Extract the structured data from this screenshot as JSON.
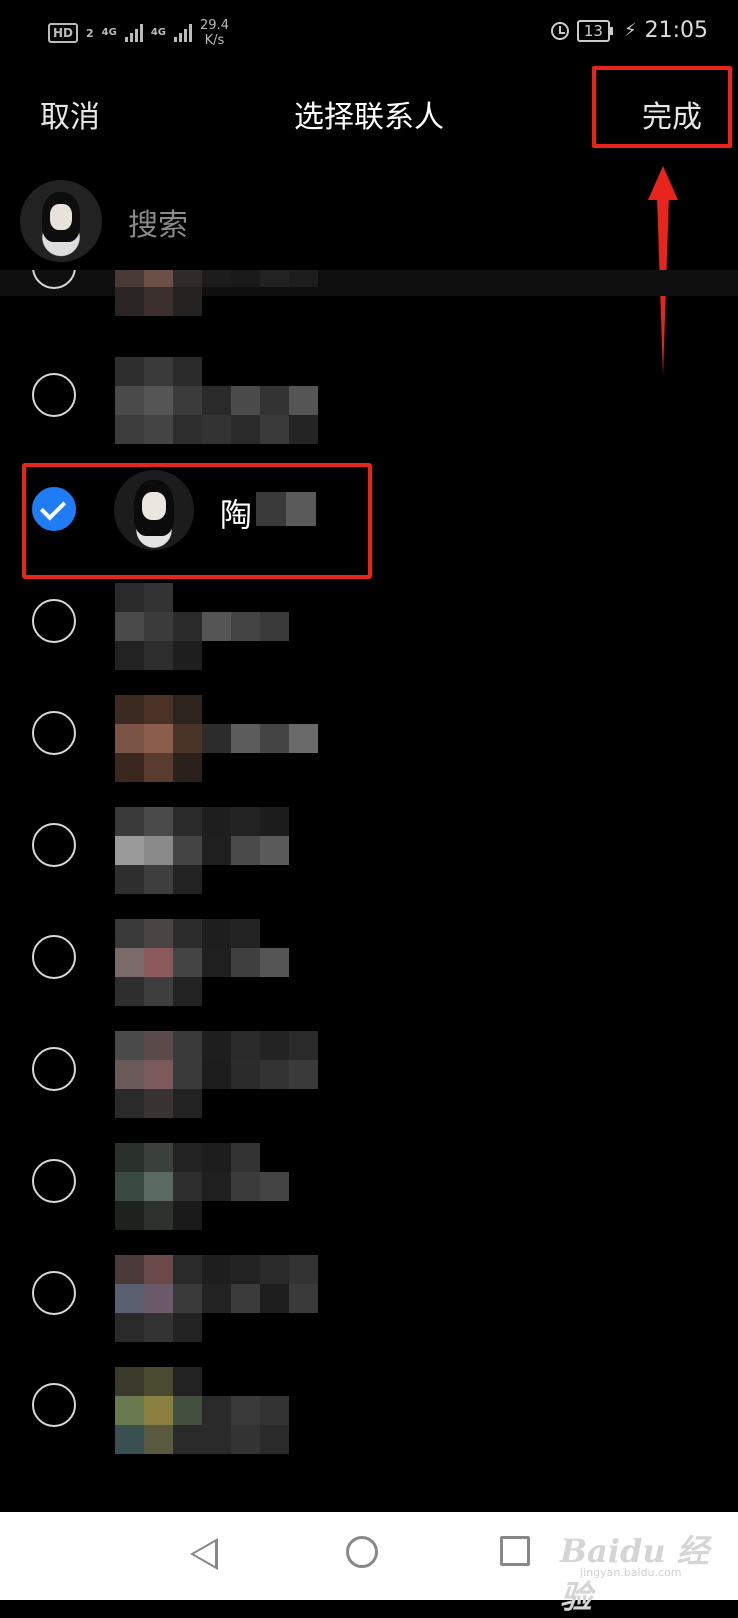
{
  "status_bar": {
    "hd_label": "HD",
    "sim_slot": "2",
    "network_1": "4G",
    "network_2": "4G",
    "speed_value": "29.4",
    "speed_unit": "K/s",
    "battery": "13",
    "time": "21:05"
  },
  "nav": {
    "cancel_label": "取消",
    "title": "选择联系人",
    "done_label": "完成"
  },
  "search": {
    "placeholder": "搜索"
  },
  "contacts": [
    {
      "checked": false,
      "name_visible": ""
    },
    {
      "checked": true,
      "name_visible": "陶"
    },
    {
      "checked": false,
      "name_visible": ""
    },
    {
      "checked": false,
      "name_visible": ""
    },
    {
      "checked": false,
      "name_visible": ""
    },
    {
      "checked": false,
      "name_visible": ""
    },
    {
      "checked": false,
      "name_visible": ""
    },
    {
      "checked": false,
      "name_visible": ""
    },
    {
      "checked": false,
      "name_visible": ""
    },
    {
      "checked": false,
      "name_visible": ""
    }
  ],
  "watermark": {
    "brand": "Baidu 经验",
    "site": "jingyan.baidu.com"
  },
  "colors": {
    "background": "#000000",
    "checked_radio": "#1f7cf4",
    "annotation_red": "#e8251d"
  },
  "icons": {
    "alarm": "alarm-icon",
    "charging": "bolt-icon",
    "checkmark": "check-icon",
    "back": "back-triangle-icon",
    "home": "home-circle-icon",
    "recents": "recents-square-icon"
  }
}
